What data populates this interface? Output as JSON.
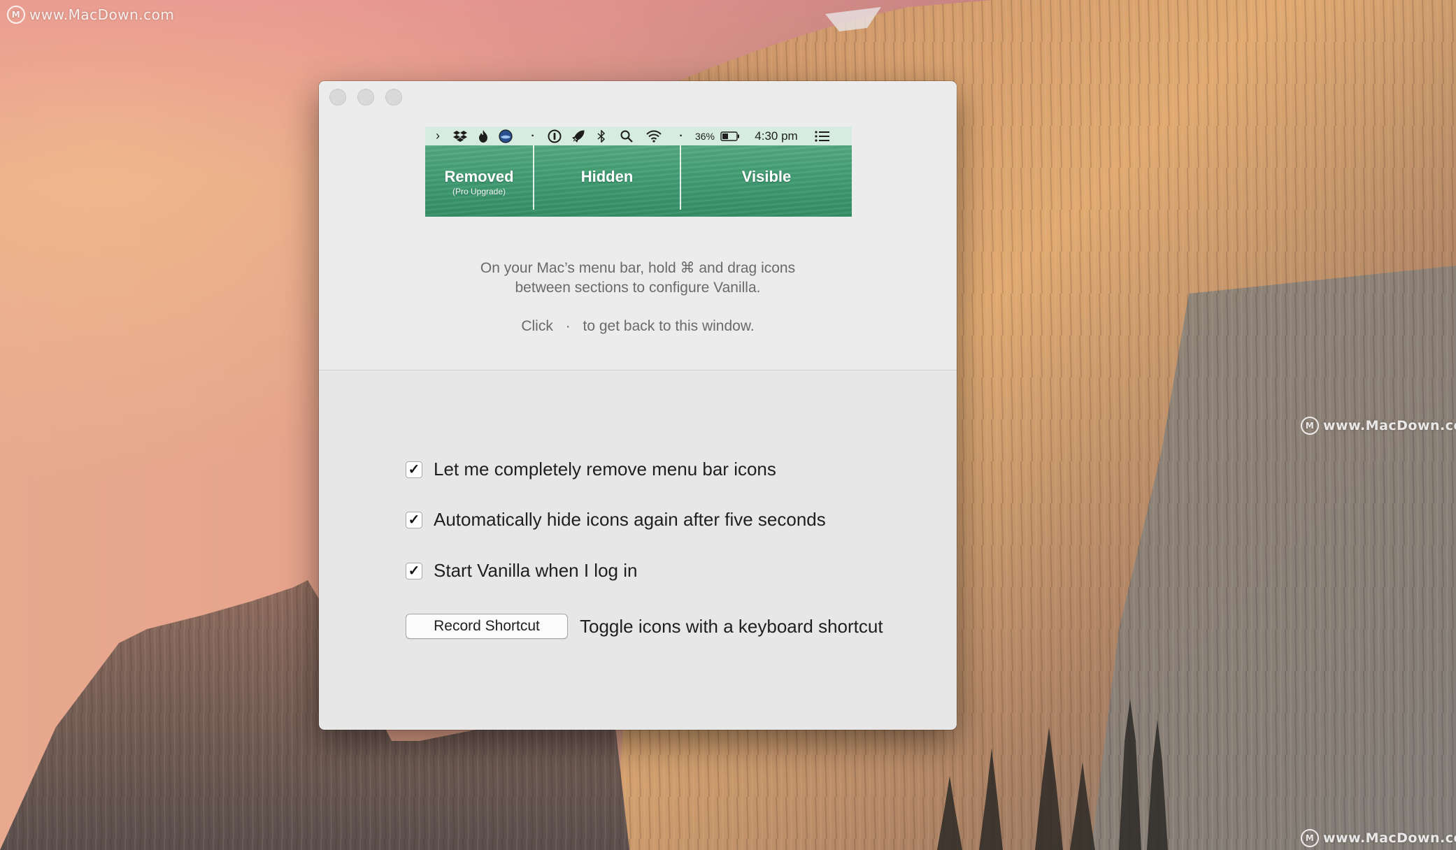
{
  "watermark": {
    "logo_letter": "M",
    "top_text": "www.MacDown.com",
    "mid_text": "www.MacDown.com",
    "bottom_text": "www.MacDown.com"
  },
  "menubar": {
    "chevron": "›",
    "separator_dot_1": "·",
    "separator_dot_2": "·",
    "battery": "36%",
    "time": "4:30 pm",
    "icons": [
      "chevron-icon",
      "dropbox-icon",
      "flame-icon",
      "globe-icon",
      "dot-separator",
      "onepassword-icon",
      "rocket-icon",
      "bluetooth-icon",
      "spotlight-icon",
      "wifi-icon",
      "dot-separator",
      "battery-icon",
      "notification-list-icon"
    ]
  },
  "sections": {
    "removed_title": "Removed",
    "removed_sub": "(Pro Upgrade)",
    "hidden_title": "Hidden",
    "visible_title": "Visible"
  },
  "instructions": {
    "line1": "On your Mac’s menu bar, hold ⌘ and drag icons",
    "line2": "between sections to configure Vanilla.",
    "click_prefix": "Click",
    "click_dot": "·",
    "click_suffix": "to get back to this window."
  },
  "options": {
    "remove_label": "Let me completely remove menu bar icons",
    "remove_checked": true,
    "autohide_label": "Automatically hide icons again after five seconds",
    "autohide_checked": true,
    "login_label": "Start Vanilla when I log in",
    "login_checked": true,
    "checkmark": "✓"
  },
  "shortcut": {
    "button_label": "Record Shortcut",
    "description": "Toggle icons with a keyboard shortcut"
  },
  "colors": {
    "section_green": "#3e9a70",
    "menubar_bg": "#d6ece0",
    "window_bg": "#e7e7e7"
  }
}
